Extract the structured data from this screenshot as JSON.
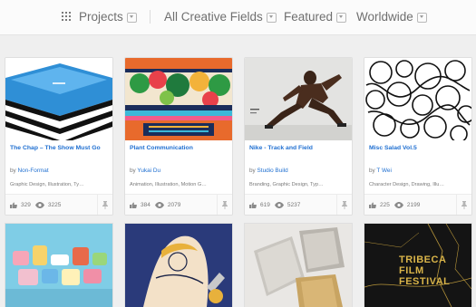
{
  "filters": {
    "projects_label": "Projects",
    "fields_label": "All Creative Fields",
    "sort_label": "Featured",
    "location_label": "Worldwide"
  },
  "projects": [
    {
      "title": "The Chap – The Show Must Go",
      "by": "by",
      "owner": "Non-Format",
      "fields": "Graphic Design, Illustration, Ty…",
      "likes": "329",
      "views": "3225"
    },
    {
      "title": "Plant Communication",
      "by": "by",
      "owner": "Yukai Du",
      "fields": "Animation, Illustration, Motion G…",
      "likes": "384",
      "views": "2079"
    },
    {
      "title": "Nike - Track and Field",
      "by": "by",
      "owner": "Studio Build",
      "fields": "Branding, Graphic Design, Typ…",
      "likes": "619",
      "views": "5237"
    },
    {
      "title": "Misc Salad Vol.5",
      "by": "by",
      "owner": "T Wei",
      "fields": "Character Design, Drawing, Illu…",
      "likes": "225",
      "views": "2199"
    }
  ],
  "bottom_row": {
    "festival_lines": [
      "TRIBECA",
      "FILM",
      "FESTIVAL"
    ]
  },
  "colors": {
    "link": "#1f6fd1",
    "text": "#6f6f6f",
    "festival_gold": "#d9b449"
  },
  "icons": [
    "grid-icon",
    "chevron-down-icon",
    "thumbs-up-icon",
    "eye-icon",
    "pin-icon"
  ]
}
